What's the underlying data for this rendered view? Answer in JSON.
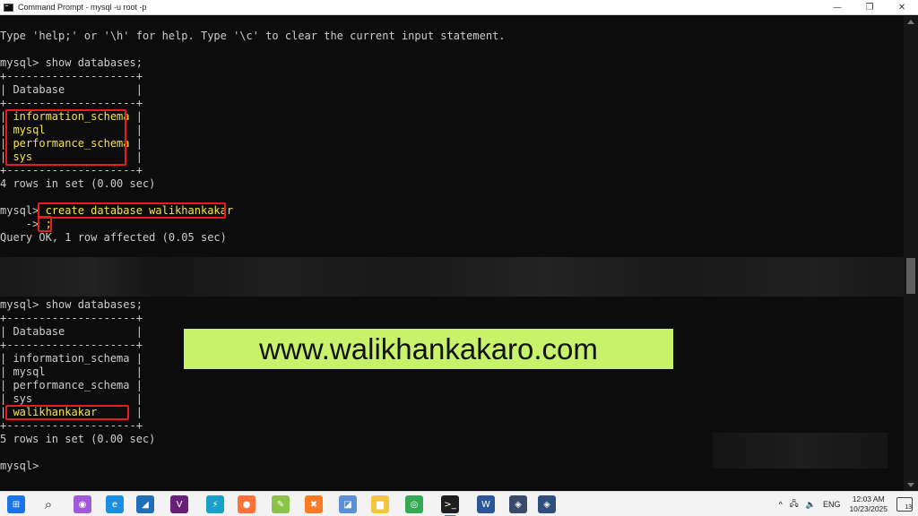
{
  "window": {
    "title": "Command Prompt - mysql  -u root -p",
    "controls": {
      "minimize": "—",
      "maximize": "❐",
      "close": "✕"
    }
  },
  "console": {
    "help_line": "Type 'help;' or '\\h' for help. Type '\\c' to clear the current input statement.",
    "block1": {
      "prompt": "mysql> ",
      "command": "show databases;",
      "border": "+--------------------+",
      "header_left": "| ",
      "header": "Database",
      "header_right": "           |",
      "rows": [
        "information_schema",
        "mysql",
        "performance_schema",
        "sys"
      ],
      "summary": "4 rows in set (0.00 sec)"
    },
    "create": {
      "prompt": "mysql> ",
      "command": "create database walikhankakar",
      "cont_prompt": "    -> ",
      "cont_text": ";",
      "result": "Query OK, 1 row affected (0.05 sec)"
    },
    "block2": {
      "prompt": "mysql> ",
      "command": "show databases;",
      "border": "+--------------------+",
      "header_left": "| ",
      "header": "Database",
      "header_right": "           |",
      "rows": [
        "information_schema",
        "mysql",
        "performance_schema",
        "sys",
        "walikhankakar"
      ],
      "summary": "5 rows in set (0.00 sec)"
    },
    "final_prompt": "mysql> "
  },
  "watermark": {
    "text": "www.walikhankakaro.com",
    "background": "#c8f26a"
  },
  "colors": {
    "console_bg": "#0c0c0c",
    "text": "#cccccc",
    "highlight_text": "#f3e54a",
    "highlight_border": "#e81c1c"
  },
  "taskbar": {
    "icons": [
      {
        "name": "windows-start-icon",
        "glyph": "⊞",
        "color": "#1a73e8"
      },
      {
        "name": "search-icon",
        "glyph": "⌕",
        "color": "#222"
      },
      {
        "name": "copilot-icon",
        "glyph": "◉",
        "color": "#a259d9"
      },
      {
        "name": "edge-icon",
        "glyph": "e",
        "color": "#1a8ee0"
      },
      {
        "name": "mysql-workbench-icon",
        "glyph": "◢",
        "color": "#1e6fb8"
      },
      {
        "name": "visual-studio-icon",
        "glyph": "V",
        "color": "#68217a"
      },
      {
        "name": "power-automate-icon",
        "glyph": "⚡",
        "color": "#19a0c8"
      },
      {
        "name": "firefox-icon",
        "glyph": "●",
        "color": "#ff7139"
      },
      {
        "name": "notepad-plus-plus-icon",
        "glyph": "✎",
        "color": "#8bc34a"
      },
      {
        "name": "xampp-icon",
        "glyph": "✖",
        "color": "#fb7a24"
      },
      {
        "name": "tool-icon",
        "glyph": "◪",
        "color": "#5b8fd6"
      },
      {
        "name": "file-explorer-icon",
        "glyph": "▆",
        "color": "#f4c542"
      },
      {
        "name": "chrome-icon",
        "glyph": "◎",
        "color": "#34a853"
      },
      {
        "name": "command-prompt-icon",
        "glyph": ">_",
        "color": "#1e1e1e"
      },
      {
        "name": "word-icon",
        "glyph": "W",
        "color": "#2b579a"
      },
      {
        "name": "sql-tool-icon",
        "glyph": "◈",
        "color": "#3a4a6b"
      },
      {
        "name": "sql-tool-2-icon",
        "glyph": "◈",
        "color": "#2f4f7f"
      }
    ],
    "tray": {
      "chevron": "^",
      "network": "🖧",
      "volume": "🔈",
      "language": "ENG",
      "time": "12:03 AM",
      "date": "10/23/2025",
      "notification_count": "13"
    }
  }
}
